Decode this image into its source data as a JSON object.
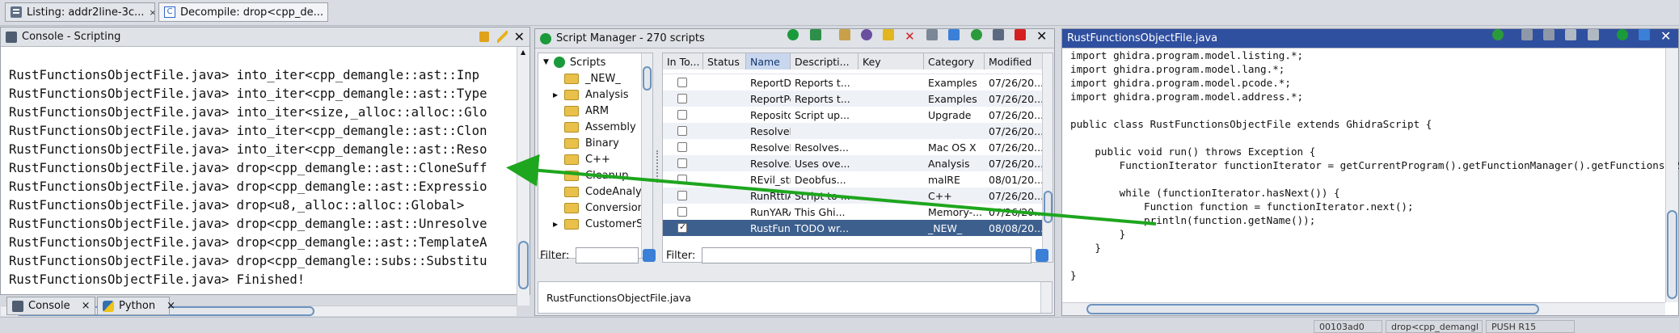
{
  "tabs": [
    {
      "label": "Listing:  addr2line-3c...",
      "close": "×"
    },
    {
      "label": "Decompile: drop<cpp_de...",
      "close": "×"
    }
  ],
  "console": {
    "title": "Console - Scripting",
    "lines": [
      "RustFunctionsObjectFile.java> into_iter<cpp_demangle::ast::Inp",
      "RustFunctionsObjectFile.java> into_iter<cpp_demangle::ast::Type",
      "RustFunctionsObjectFile.java> into_iter<size,_alloc::alloc::Glo",
      "RustFunctionsObjectFile.java> into_iter<cpp_demangle::ast::Clon",
      "RustFunctionsObjectFile.java> into_iter<cpp_demangle::ast::Reso",
      "RustFunctionsObjectFile.java> drop<cpp_demangle::ast::CloneSuff",
      "RustFunctionsObjectFile.java> drop<cpp_demangle::ast::Expressio",
      "RustFunctionsObjectFile.java> drop<u8,_alloc::alloc::Global>",
      "RustFunctionsObjectFile.java> drop<cpp_demangle::ast::Unresolve",
      "RustFunctionsObjectFile.java> drop<cpp_demangle::ast::TemplateA",
      "RustFunctionsObjectFile.java> drop<cpp_demangle::subs::Substitu",
      "RustFunctionsObjectFile.java> Finished!"
    ],
    "bottom_tabs": [
      {
        "label": "Console",
        "close": "×"
      },
      {
        "label": "Python",
        "close": "×"
      }
    ]
  },
  "script_manager": {
    "title": "Script Manager - 270 scripts",
    "tree": [
      {
        "label": "Scripts",
        "kind": "root"
      },
      {
        "label": "_NEW_",
        "kind": "folder"
      },
      {
        "label": "Analysis",
        "kind": "folder-expandable"
      },
      {
        "label": "ARM",
        "kind": "folder"
      },
      {
        "label": "Assembly",
        "kind": "folder"
      },
      {
        "label": "Binary",
        "kind": "folder"
      },
      {
        "label": "C++",
        "kind": "folder"
      },
      {
        "label": "Cleanup",
        "kind": "folder"
      },
      {
        "label": "CodeAnalysis",
        "kind": "folder"
      },
      {
        "label": "Conversion",
        "kind": "folder"
      },
      {
        "label": "CustomerSub",
        "kind": "folder-expandable"
      }
    ],
    "columns": [
      "In To...",
      "Status",
      "Name",
      "Descripti...",
      "Key",
      "Category",
      "Modified"
    ],
    "rows": [
      {
        "name": "ReportDi...",
        "desc": "Reports t...",
        "key": "",
        "category": "Examples",
        "modified": "07/26/20...",
        "checked": false
      },
      {
        "name": "ReportPe...",
        "desc": "Reports t...",
        "key": "",
        "category": "Examples",
        "modified": "07/26/20...",
        "checked": false
      },
      {
        "name": "Reposito...",
        "desc": "Script up...",
        "key": "",
        "category": "Upgrade",
        "modified": "07/26/20...",
        "checked": false
      },
      {
        "name": "ResolveE...",
        "desc": "",
        "key": "",
        "category": "",
        "modified": "07/26/20...",
        "checked": false
      },
      {
        "name": "ResolveR...",
        "desc": "Resolves...",
        "key": "",
        "category": "Mac OS X",
        "modified": "07/26/20...",
        "checked": false
      },
      {
        "name": "ResolveX...",
        "desc": "Uses ove...",
        "key": "",
        "category": "Analysis",
        "modified": "07/26/20...",
        "checked": false
      },
      {
        "name": "REvil_stri...",
        "desc": "Deobfus...",
        "key": "",
        "category": "malRE",
        "modified": "08/01/20...",
        "checked": false
      },
      {
        "name": "RunRttiAn...",
        "desc": "Script to ...",
        "key": "",
        "category": "C++",
        "modified": "07/26/20...",
        "checked": false
      },
      {
        "name": "RunYARA...",
        "desc": "This Ghi...",
        "key": "",
        "category": "Memory-...",
        "modified": "07/26/20...",
        "checked": false
      },
      {
        "name": "RustFunc...",
        "desc": "TODO wr...",
        "key": "",
        "category": "_NEW_",
        "modified": "08/08/20...",
        "checked": true
      }
    ],
    "filter_label": "Filter:",
    "filter_value": "",
    "selected_file": "RustFunctionsObjectFile.java"
  },
  "editor": {
    "title": "RustFunctionsObjectFile.java",
    "code": [
      "import ghidra.program.model.listing.*;",
      "import ghidra.program.model.lang.*;",
      "import ghidra.program.model.pcode.*;",
      "import ghidra.program.model.address.*;",
      "",
      "public class RustFunctionsObjectFile extends GhidraScript {",
      "",
      "    public void run() throws Exception {",
      "        FunctionIterator functionIterator = getCurrentProgram().getFunctionManager().getFunctionsNoStubs(",
      "",
      "        while (functionIterator.hasNext()) {",
      "            Function function = functionIterator.next();",
      "            println(function.getName());",
      "        }",
      "    }",
      "",
      "}"
    ]
  },
  "statusbar": {
    "address": "00103ad0",
    "function": "drop<cpp_demangl",
    "instruction": "PUSH R15"
  },
  "colors": {
    "arrow": "#1ea61e",
    "title_active": "#2f4f9f",
    "selection": "#3d5f8d"
  }
}
